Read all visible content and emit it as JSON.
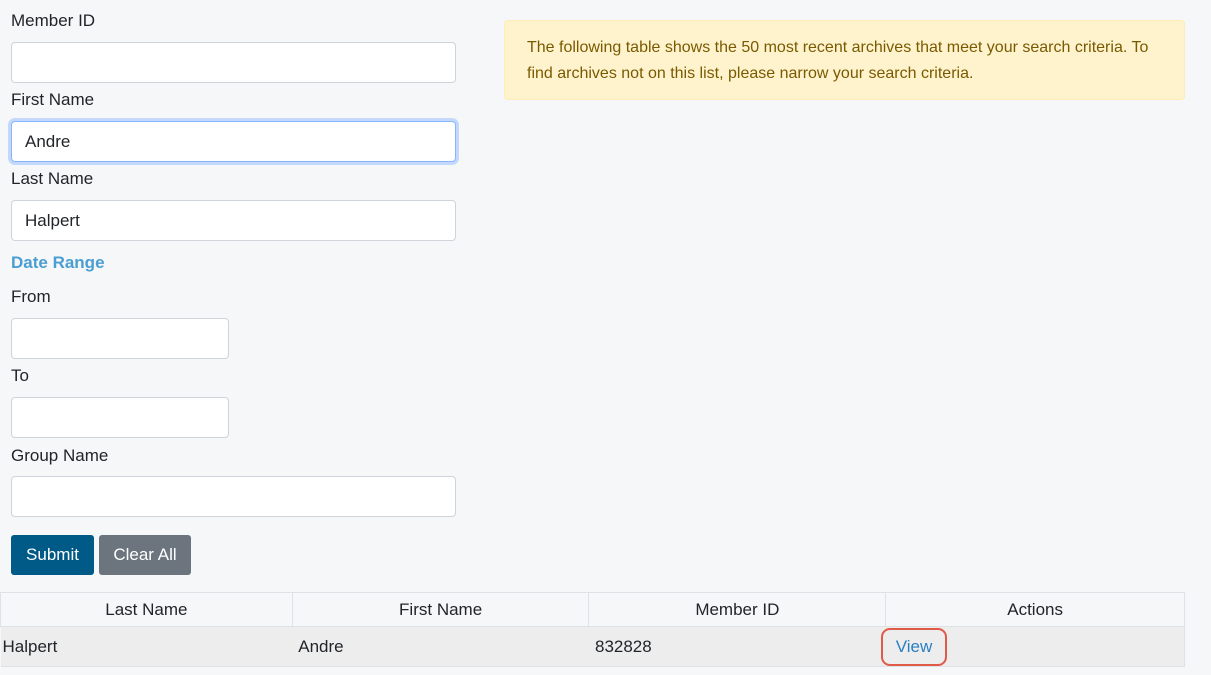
{
  "form": {
    "member_id": {
      "label": "Member ID",
      "value": "",
      "placeholder": ""
    },
    "first_name": {
      "label": "First Name",
      "value": "Andre",
      "placeholder": ""
    },
    "last_name": {
      "label": "Last Name",
      "value": "Halpert",
      "placeholder": ""
    },
    "date_range": {
      "title": "Date Range",
      "from": {
        "label": "From",
        "value": ""
      },
      "to": {
        "label": "To",
        "value": ""
      }
    },
    "group_name": {
      "label": "Group Name",
      "value": ""
    },
    "submit_label": "Submit",
    "clear_label": "Clear All"
  },
  "alert": {
    "text": "The following table shows the 50 most recent archives that meet your search criteria. To find archives not on this list, please narrow your search criteria."
  },
  "table": {
    "headers": [
      "Last Name",
      "First Name",
      "Member ID",
      "Actions"
    ],
    "rows": [
      {
        "last_name": "Halpert",
        "first_name": "Andre",
        "member_id": "832828",
        "action": "View"
      }
    ]
  },
  "colors": {
    "primary": "#005a87",
    "secondary": "#6c757d",
    "accent": "#4a9ed1",
    "link": "#2a7fc2",
    "highlight": "#e05a48",
    "alert_bg": "#fff3cd"
  }
}
